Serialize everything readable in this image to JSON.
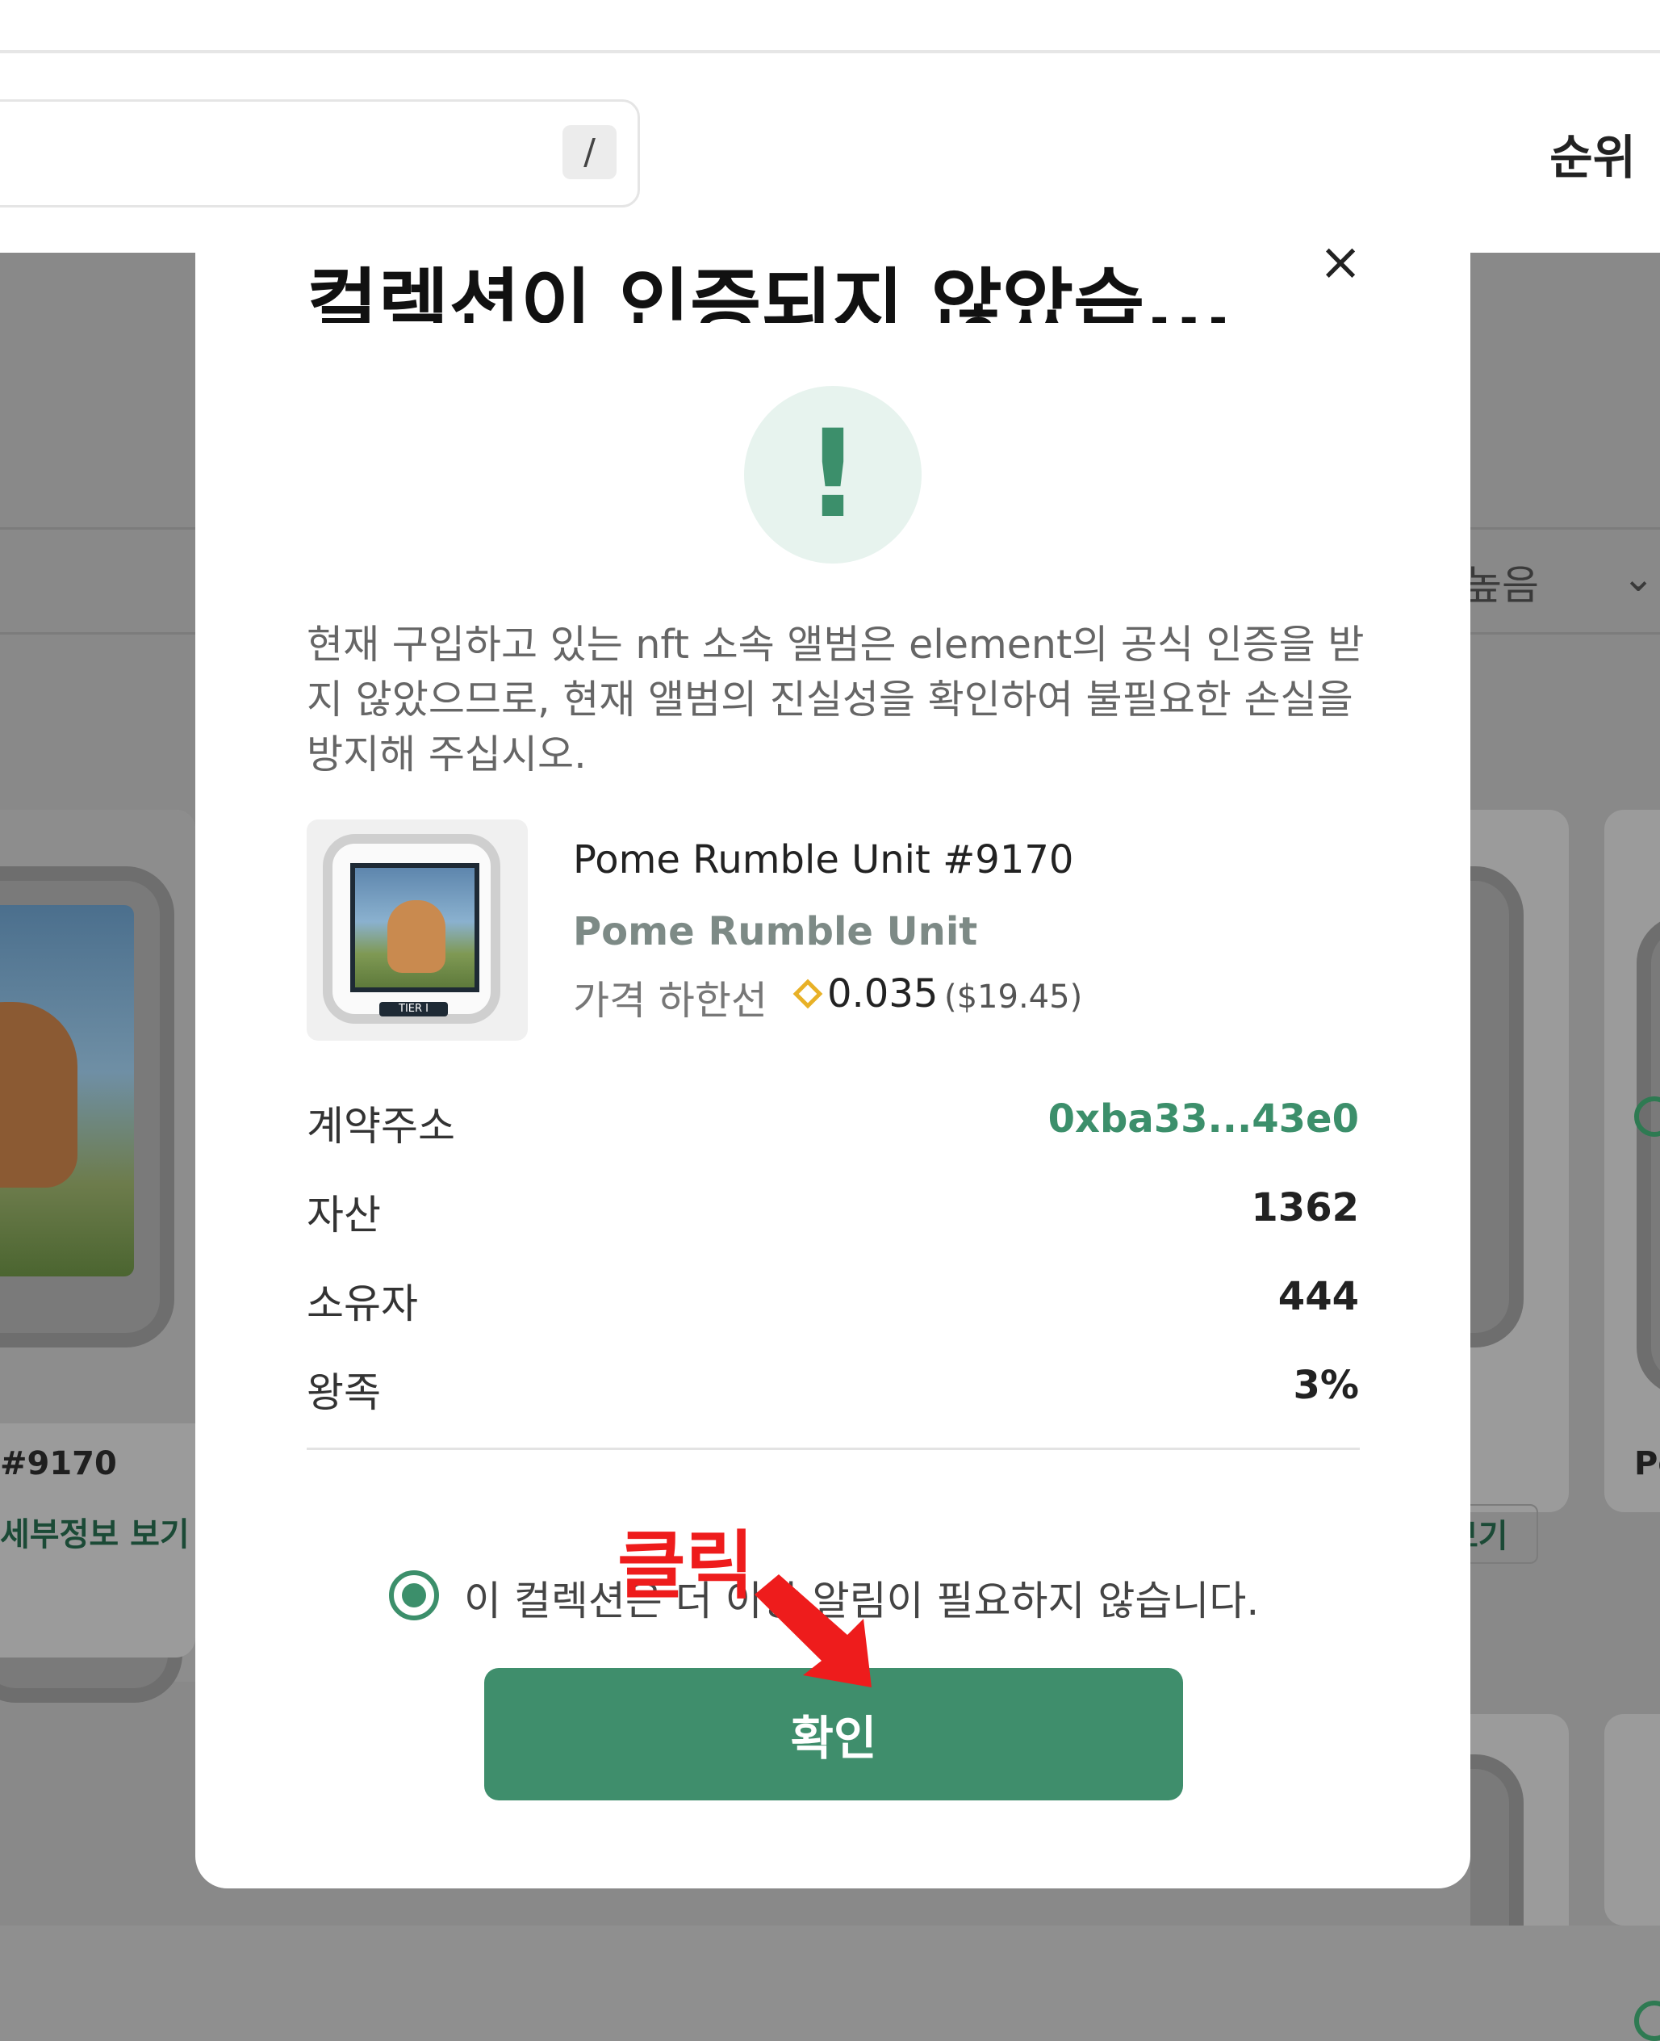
{
  "header": {
    "search_shortcut": "/",
    "nav_rank": "순위"
  },
  "background": {
    "sort_label": "높음",
    "card1_title": "#9170",
    "card1_link": "세부정보 보기",
    "card2_link": "보기",
    "card3_title": "Po"
  },
  "modal": {
    "title": "컬렉션이 인증되지 않았습...",
    "close_icon": "×",
    "warning_icon": "!",
    "description": "현재 구입하고 있는 nft 소속 앨범은 element의 공식 인증을 받지 않았으므로, 현재 앨범의 진실성을 확인하여 불필요한 손실을 방지해 주십시오.",
    "nft": {
      "name": "Pome Rumble Unit #9170",
      "collection": "Pome Rumble Unit",
      "floor_label": "가격 하한선",
      "floor_value": "0.035",
      "floor_usd": "($19.45)",
      "thumb_tier": "TIER I"
    },
    "info": [
      {
        "label": "계약주소",
        "value": "0xba33...43e0"
      },
      {
        "label": "자산",
        "value": "1362"
      },
      {
        "label": "소유자",
        "value": "444"
      },
      {
        "label": "왕족",
        "value": "3%"
      }
    ],
    "checkbox_label": "이 컬렉션은 더 이상 알림이 필요하지 않습니다.",
    "confirm_label": "확인",
    "colors": {
      "accent": "#3f8e6c",
      "contract": "#3c8f6b"
    }
  },
  "annotation": {
    "click_label": "클릭",
    "arrow_color": "#ee1c1c"
  }
}
